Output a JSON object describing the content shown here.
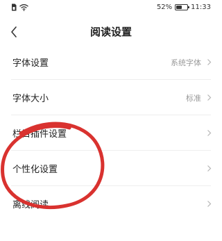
{
  "status_bar": {
    "battery_percent": "52%",
    "battery_level": 0.52,
    "time": "11:33",
    "left_icons": [
      "sim-icon",
      "wifi-icon"
    ]
  },
  "header": {
    "title": "阅读设置",
    "back_icon": "chevron-left-icon"
  },
  "settings": {
    "items": [
      {
        "label": "字体设置",
        "value": "系统字体"
      },
      {
        "label": "字体大小",
        "value": "标准"
      },
      {
        "label": "栏目插件设置",
        "value": ""
      },
      {
        "label": "个性化设置",
        "value": ""
      },
      {
        "label": "离线阅读",
        "value": ""
      }
    ],
    "chevron_icon": "chevron-right-icon"
  },
  "annotation": {
    "shape": "hand-drawn-circle",
    "color": "#d9322f",
    "target": "个性化设置"
  },
  "colors": {
    "text_primary": "#222222",
    "text_secondary": "#9a9a9a",
    "divider": "#eeeeee",
    "background": "#ffffff"
  }
}
